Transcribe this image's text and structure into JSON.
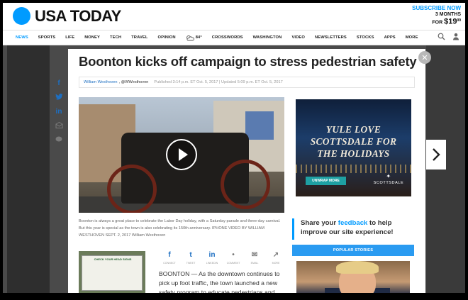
{
  "header": {
    "logo_text": "USA TODAY",
    "subscribe_line1": "SUBSCRIBE NOW",
    "subscribe_line2": "3 MONTHS",
    "subscribe_line3_prefix": "FOR ",
    "subscribe_price": "$19",
    "subscribe_cents": "99"
  },
  "nav": {
    "items": [
      "NEWS",
      "SPORTS",
      "LIFE",
      "MONEY",
      "TECH",
      "TRAVEL",
      "OPINION"
    ],
    "weather_temp": "84°",
    "items_after": [
      "CROSSWORDS",
      "WASHINGTON",
      "VIDEO",
      "NEWSLETTERS",
      "STOCKS",
      "APPS",
      "MORE"
    ],
    "active_item": "NEWS"
  },
  "article": {
    "headline": "Boonton kicks off campaign to stress pedestrian safety",
    "author": "William Westhoven",
    "handle": ", @WWesthoven",
    "published": "Published 3:14 p.m. ET Oct. 5, 2017 | Updated 5:09 p.m. ET Oct. 5, 2017",
    "caption": "Boonton is always a great place to celebrate the Labor Day holiday, with a Saturday parade and three-day carnival. But this year is special as the town is also celebrating its 150th anniversary. IPHONE VIDEO BY WILLIAM WESTHOVEN SEPT. 2, 2017 William Westhoven",
    "body": "BOONTON — As the downtown continues to pick up foot traffic, the town launched a new safety program to educate pedestrians and drivers navigating the",
    "thumb_sign_text": "CHECK YOUR HEAD SIGNS"
  },
  "share_rail": [
    "f",
    "t",
    "in",
    "mail",
    "comment"
  ],
  "share_row": [
    {
      "icon": "f",
      "label": "CONNECT"
    },
    {
      "icon": "t",
      "label": "TWEET"
    },
    {
      "icon": "in",
      "label": "LINKEDIN"
    },
    {
      "icon": "•",
      "label": "COMMENT"
    },
    {
      "icon": "✉",
      "label": "EMAIL"
    },
    {
      "icon": "↗",
      "label": "MORE"
    }
  ],
  "ad": {
    "headline_line1": "YULE LOVE",
    "headline_line2": "SCOTTSDALE FOR",
    "headline_line3": "THE HOLIDAYS",
    "cta": "UNWRAP MORE",
    "brand": "SCOTTSDALE"
  },
  "feedback": {
    "prefix": "Share your ",
    "link": "feedback",
    "suffix": " to help improve our site experience!"
  },
  "popular": {
    "title": "POPULAR STORIES"
  },
  "colors": {
    "brand_blue": "#009bff",
    "link_blue": "#1d6fc2",
    "popular_bar": "#2a9bf1",
    "ad_cta": "#1ea0a3"
  },
  "icons": {
    "close": "close-icon",
    "next": "chevron-right-icon",
    "search": "search-icon",
    "user": "user-icon",
    "play": "play-icon",
    "weather": "partly-cloudy-icon"
  }
}
